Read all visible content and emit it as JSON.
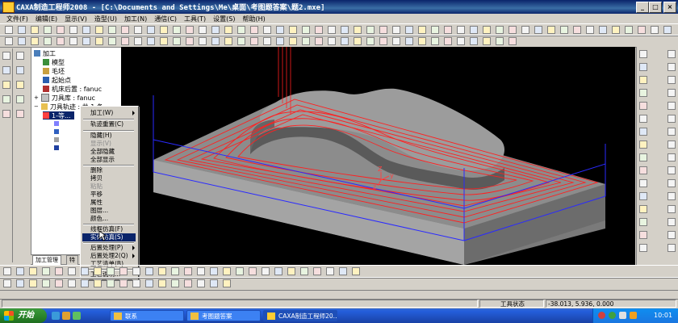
{
  "titlebar": {
    "title": "CAXA制造工程师2008  - [C:\\Documents and Settings\\Me\\桌面\\考图题答案\\题2.mxe]"
  },
  "menubar": [
    "文件(F)",
    "编辑(E)",
    "显示(V)",
    "造型(U)",
    "加工(N)",
    "通信(C)",
    "工具(T)",
    "设置(S)",
    "帮助(H)"
  ],
  "tree": {
    "items": [
      {
        "label": "加工"
      },
      {
        "label": "模型"
      },
      {
        "label": "毛坯"
      },
      {
        "label": "起始点"
      },
      {
        "label": "机床后置 : fanuc"
      },
      {
        "label": "刀具库 : fanuc"
      },
      {
        "label": "刀具轨迹 : 共 1 条"
      },
      {
        "label": "1-等..."
      }
    ],
    "tabs": [
      "加工管理",
      "特"
    ]
  },
  "context_menu": {
    "items": [
      {
        "label": "加工(W)",
        "submenu": true,
        "disabled": false
      },
      {
        "label": "轨迹重置(C)",
        "disabled": false
      },
      {
        "label": "隐藏(H)",
        "disabled": false
      },
      {
        "label": "显示(V)",
        "disabled": true
      },
      {
        "label": "全部隐藏",
        "disabled": false
      },
      {
        "label": "全部显示",
        "disabled": false
      },
      {
        "label": "删除",
        "disabled": false
      },
      {
        "label": "拷贝",
        "disabled": false
      },
      {
        "label": "粘贴",
        "disabled": true
      },
      {
        "label": "平移",
        "disabled": false
      },
      {
        "label": "属性",
        "disabled": false
      },
      {
        "label": "图层...",
        "disabled": false
      },
      {
        "label": "颜色...",
        "disabled": false
      },
      {
        "label": "线框仿真(F)",
        "disabled": false
      },
      {
        "label": "实体仿真(S)",
        "disabled": false,
        "highlighted": true
      },
      {
        "label": "后置处理(P)",
        "submenu": true,
        "disabled": false
      },
      {
        "label": "后置处理2(Q)",
        "submenu": true,
        "disabled": false
      },
      {
        "label": "工艺清单(B)",
        "disabled": false
      },
      {
        "label": "工艺说明...",
        "disabled": false
      }
    ]
  },
  "status": {
    "state_label": "工具状态",
    "coords": "-38.013, 5.936, 0.000"
  },
  "taskbar": {
    "start": "开始",
    "tasks": [
      {
        "label": "联系"
      },
      {
        "label": "考图题答案"
      },
      {
        "label": "CAXA制造工程师20..."
      }
    ],
    "clock": "10:01"
  },
  "colors": {
    "accent": "#0a246a",
    "toolpath": "#ff2020",
    "box": "#2a2aff",
    "viewport": "#000000"
  }
}
